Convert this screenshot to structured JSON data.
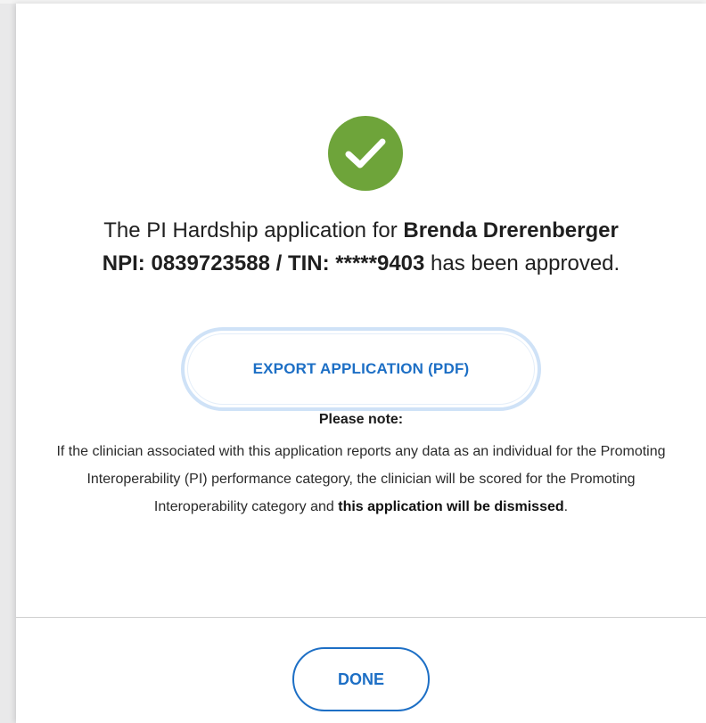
{
  "dialog": {
    "status_icon": "checkmark-circle-icon",
    "message": {
      "prefix": "The PI Hardship application for ",
      "clinician_name": "Brenda Drerenberger",
      "identifiers": "NPI: 0839723588 / TIN: *****9403",
      "suffix": " has been approved."
    },
    "export_button_label": "EXPORT APPLICATION (PDF)",
    "note": {
      "title": "Please note:",
      "body_prefix": "If the clinician associated with this application reports any data as an individual for the Promoting Interoperability (PI) performance category, the clinician will be scored for the Promoting Interoperability category and ",
      "body_bold": "this application will be dismissed",
      "body_suffix": "."
    },
    "done_button_label": "DONE"
  },
  "colors": {
    "success_green": "#6ea43a",
    "primary_blue": "#1d6fc5",
    "focus_ring": "#cfe2f7"
  }
}
